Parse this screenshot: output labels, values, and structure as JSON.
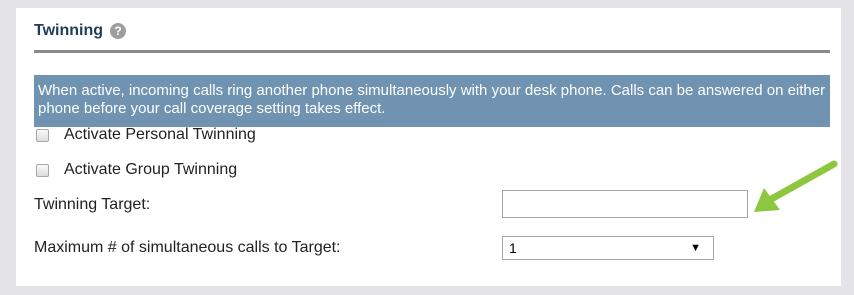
{
  "section": {
    "title": "Twinning",
    "help_icon": "?"
  },
  "info": {
    "text": "When active, incoming calls ring another phone simultaneously with your desk phone. Calls can be answered on either phone before your call coverage setting takes effect."
  },
  "options": {
    "personal": {
      "label": "Activate Personal Twinning",
      "checked": false
    },
    "group": {
      "label": "Activate Group Twinning",
      "checked": false
    }
  },
  "target": {
    "label": "Twinning Target:",
    "value": ""
  },
  "max_calls": {
    "label": "Maximum # of simultaneous calls to Target:",
    "selected": "1"
  },
  "colors": {
    "info_bg": "#6f93b0",
    "arrow": "#8dc63f",
    "title": "#1f3e5a"
  }
}
